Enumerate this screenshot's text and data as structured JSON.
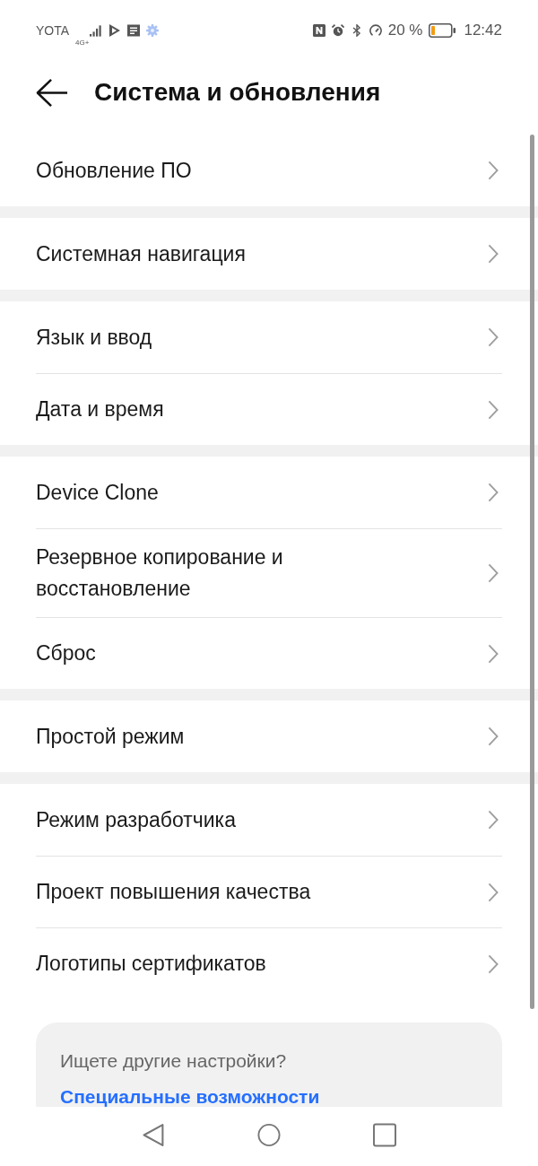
{
  "status_bar": {
    "carrier": "YOTA",
    "network_type": "4G+",
    "battery_text": "20 %",
    "time": "12:42"
  },
  "header": {
    "title": "Система и обновления"
  },
  "groups": [
    {
      "items": [
        {
          "label": "Обновление ПО"
        }
      ]
    },
    {
      "items": [
        {
          "label": "Системная навигация"
        }
      ]
    },
    {
      "items": [
        {
          "label": "Язык и ввод"
        },
        {
          "label": "Дата и время"
        }
      ]
    },
    {
      "items": [
        {
          "label": "Device Clone"
        },
        {
          "label": "Резервное копирование и восстановление"
        },
        {
          "label": "Сброс"
        }
      ]
    },
    {
      "items": [
        {
          "label": "Простой режим"
        }
      ]
    },
    {
      "items": [
        {
          "label": "Режим разработчика"
        },
        {
          "label": "Проект повышения качества"
        },
        {
          "label": "Логотипы сертификатов"
        }
      ]
    }
  ],
  "suggestion_card": {
    "title": "Ищете другие настройки?",
    "link": "Специальные возможности"
  }
}
